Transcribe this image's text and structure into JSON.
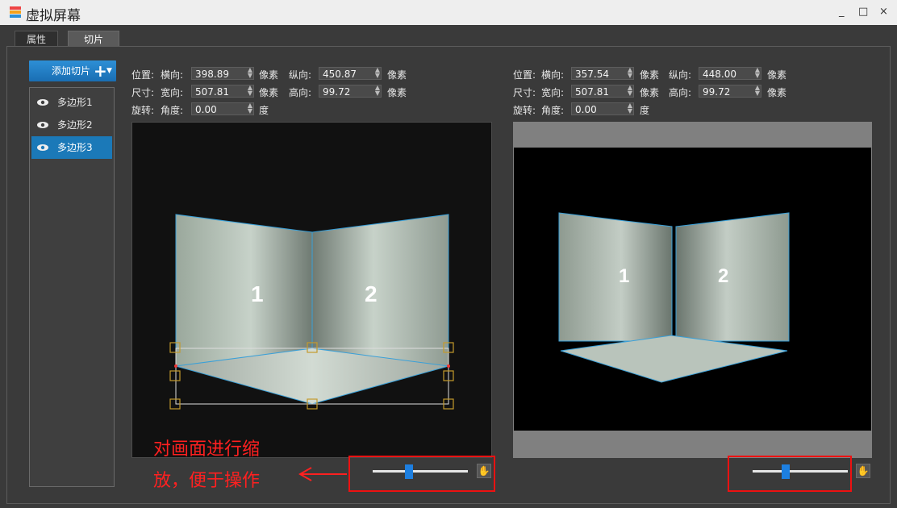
{
  "window": {
    "title": "虚拟屏幕",
    "minimize": "_",
    "maximize": "□",
    "close": "×"
  },
  "tabs": [
    {
      "label": "属性"
    },
    {
      "label": "切片"
    }
  ],
  "add_button": {
    "label": "添加切片",
    "icon": "plus-icon"
  },
  "layers": [
    {
      "label": "多边形1",
      "icon": "eye-icon",
      "selected": false
    },
    {
      "label": "多边形2",
      "icon": "eye-icon",
      "selected": false
    },
    {
      "label": "多边形3",
      "icon": "eye-icon",
      "selected": true
    }
  ],
  "left_panel": {
    "position": {
      "label": "位置:",
      "h_label": "横向:",
      "h_value": "398.89",
      "h_unit": "像素",
      "v_label": "纵向:",
      "v_value": "450.87",
      "v_unit": "像素"
    },
    "size": {
      "label": "尺寸:",
      "w_label": "宽向:",
      "w_value": "507.81",
      "w_unit": "像素",
      "h_label": "高向:",
      "h_value": "99.72",
      "h_unit": "像素"
    },
    "rotation": {
      "label": "旋转:",
      "a_label": "角度:",
      "a_value": "0.00",
      "a_unit": "度"
    },
    "numbers": {
      "n1": "1",
      "n2": "2"
    },
    "zoom_level": 0.38
  },
  "right_panel": {
    "position": {
      "label": "位置:",
      "h_label": "横向:",
      "h_value": "357.54",
      "h_unit": "像素",
      "v_label": "纵向:",
      "v_value": "448.00",
      "v_unit": "像素"
    },
    "size": {
      "label": "尺寸:",
      "w_label": "宽向:",
      "w_value": "507.81",
      "w_unit": "像素",
      "h_label": "高向:",
      "h_value": "99.72",
      "h_unit": "像素"
    },
    "rotation": {
      "label": "旋转:",
      "a_label": "角度:",
      "a_value": "0.00",
      "a_unit": "度"
    },
    "numbers": {
      "n1": "1",
      "n2": "2"
    },
    "zoom_level": 0.35
  },
  "annotation": {
    "line1": "对画面进行缩",
    "line2": "放，便于操作",
    "color": "#ff2020"
  },
  "colors": {
    "accent": "#1b79b8",
    "slider": "#1d7fe0",
    "highlight": "#e11111"
  }
}
